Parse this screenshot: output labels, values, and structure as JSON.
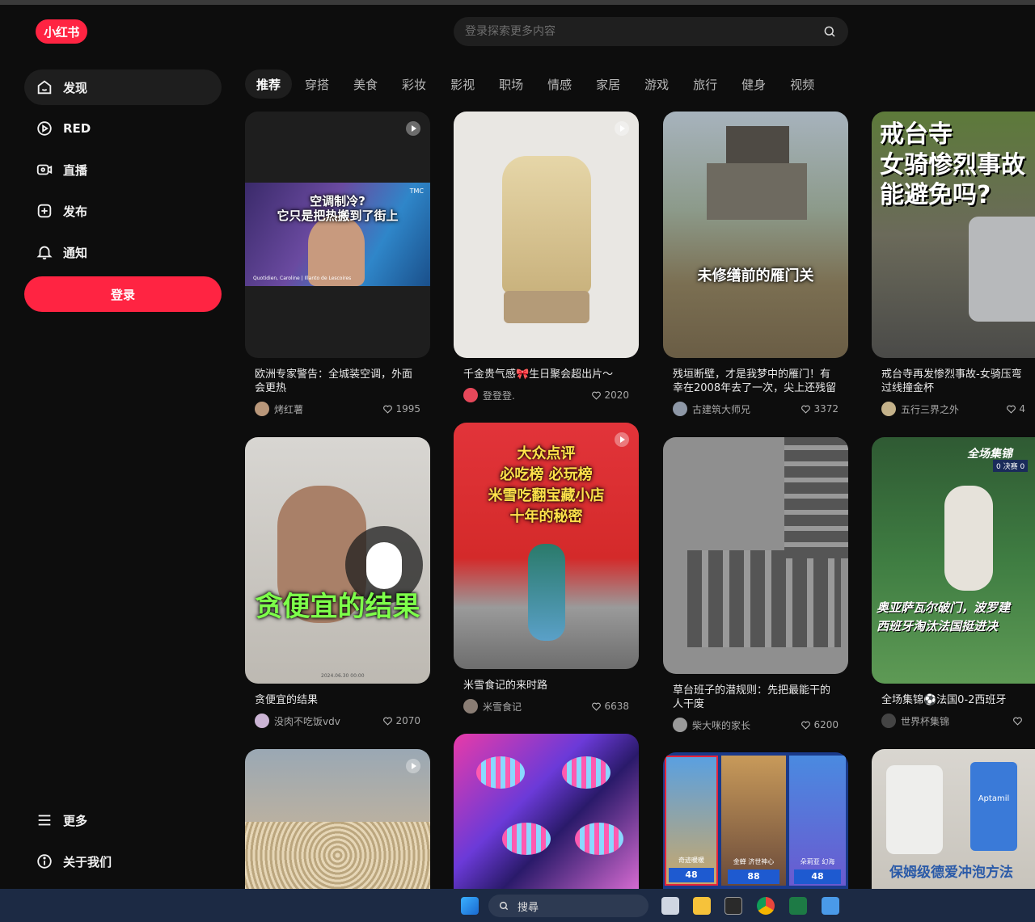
{
  "brand": {
    "logo_text": "小红书",
    "accent": "#ff2442"
  },
  "search": {
    "placeholder": "登录探索更多内容",
    "icon": "search-icon"
  },
  "sidebar": {
    "items": [
      {
        "label": "发现",
        "icon": "home-icon",
        "active": true
      },
      {
        "label": "RED",
        "icon": "play-circle-icon"
      },
      {
        "label": "直播",
        "icon": "live-icon"
      },
      {
        "label": "发布",
        "icon": "plus-square-icon"
      },
      {
        "label": "通知",
        "icon": "bell-icon"
      }
    ],
    "login_label": "登录",
    "bottom": [
      {
        "label": "更多",
        "icon": "menu-icon"
      },
      {
        "label": "关于我们",
        "icon": "info-icon"
      }
    ]
  },
  "tabs": [
    "推荐",
    "穿搭",
    "美食",
    "彩妆",
    "影视",
    "职场",
    "情感",
    "家居",
    "游戏",
    "旅行",
    "健身",
    "视频"
  ],
  "feed": [
    {
      "title": "欧洲专家警告：全城装空调，外面会更热",
      "author": "烤红薯",
      "likes": "1995",
      "overlay": "空调制冷?\n它只是把热搬到了街上",
      "caption": "Quotidien, Caroline | Illanto de Lescoires",
      "badge": "TMC"
    },
    {
      "title": "千金贵气感🎀生日聚会超出片～",
      "author": "登登登.",
      "likes": "2020"
    },
    {
      "title": "残垣断壁，才是我梦中的雁门！有幸在2008年去了一次，尖上还残留冰…",
      "author": "古建筑大师兄",
      "likes": "3372",
      "overlay": "未修缮前的雁门关"
    },
    {
      "title": "戒台寺再发惨烈事故-女骑压弯过线撞金杯",
      "author": "五行三界之外",
      "likes": "4",
      "overlay": "戒台寺\n女骑惨烈事故\n能避免吗?"
    },
    {
      "title": "贪便宜的结果",
      "author": "没肉不吃饭vdv",
      "likes": "2070",
      "overlay": "贪便宜的结果",
      "stamp": "2024.06.30 00:00"
    },
    {
      "title": "米雪食记的来时路",
      "author": "米雪食记",
      "likes": "6638",
      "overlay": "大众点评\n必吃榜 必玩榜\n米雪吃翻宝藏小店\n十年的秘密"
    },
    {
      "title": "草台班子的潜规则：先把最能干的人干废",
      "author": "柴大咪的家长",
      "likes": "6200"
    },
    {
      "title": "全场集锦⚽法国0-2西班牙",
      "author": "世界杯集锦",
      "likes": "",
      "overlay": "奥亚萨瓦尔破门，波罗建\n西班牙淘汰法国挺进决",
      "badge": "全场集锦",
      "score": "0 决赛 0"
    },
    {
      "title": "",
      "author": "",
      "likes": ""
    },
    {
      "title": "",
      "author": "",
      "likes": ""
    },
    {
      "title": "",
      "author": "",
      "likes": "",
      "game_labels": [
        "奇迹暖暖",
        "金蝉 济世神心",
        "朵莉亚 幻海"
      ],
      "game_values": [
        "48",
        "88",
        "48"
      ]
    },
    {
      "title": "",
      "author": "",
      "likes": "",
      "overlay": "保姆级德爱冲泡方法",
      "brand": "Aptamil"
    }
  ],
  "taskbar": {
    "search_label": "搜尋"
  }
}
